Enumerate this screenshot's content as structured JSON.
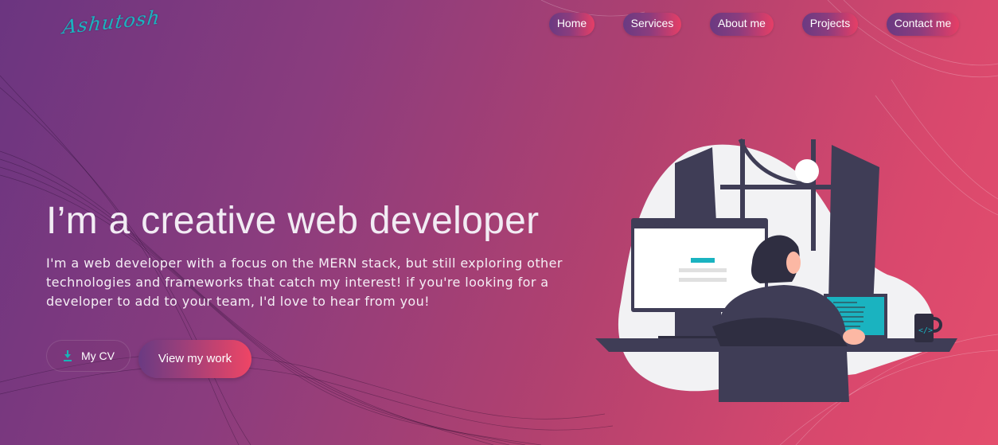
{
  "logo": {
    "text": "Ashutosh"
  },
  "nav": {
    "items": [
      {
        "label": "Home"
      },
      {
        "label": "Services"
      },
      {
        "label": "About me"
      },
      {
        "label": "Projects"
      },
      {
        "label": "Contact me"
      }
    ]
  },
  "hero": {
    "title": "I’m a creative web developer",
    "description": "I'm a web developer with a focus on the MERN stack, but still exploring other technologies and frameworks that catch my interest! if you're looking for a developer to add to your team, I'd love to hear from you!",
    "cv_button": "My CV",
    "work_button": "View my work"
  },
  "colors": {
    "accent_teal": "#1ab3c0",
    "gradient_start": "#6b3580",
    "gradient_end": "#e44e6d"
  },
  "icons": {
    "download": "download-icon",
    "illustration": "developer-at-desk-illustration"
  }
}
